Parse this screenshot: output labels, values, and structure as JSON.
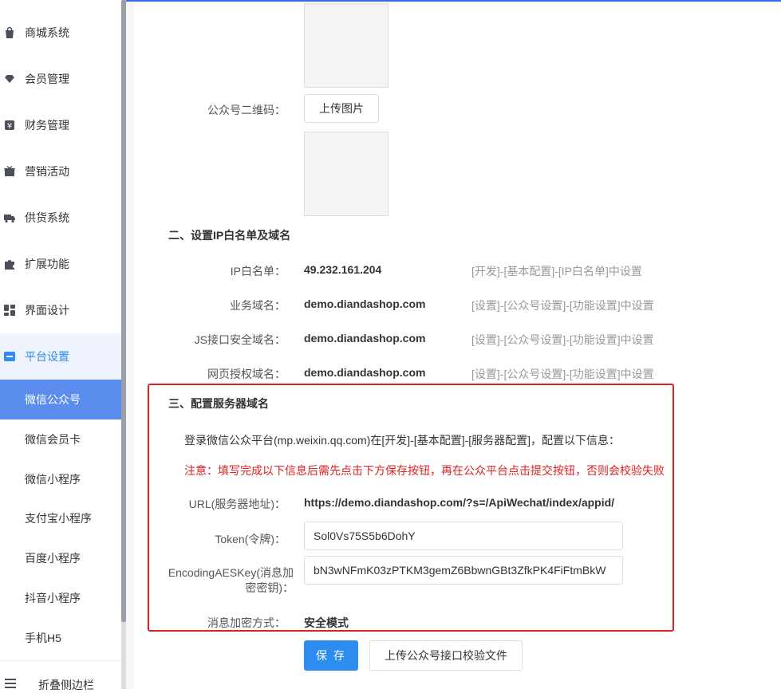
{
  "sidebar": {
    "items": [
      {
        "label": "商城系统",
        "icon": "shopping-bag-icon"
      },
      {
        "label": "会员管理",
        "icon": "diamond-icon"
      },
      {
        "label": "财务管理",
        "icon": "yen-icon"
      },
      {
        "label": "营销活动",
        "icon": "gift-icon"
      },
      {
        "label": "供货系统",
        "icon": "truck-icon"
      },
      {
        "label": "扩展功能",
        "icon": "puzzle-icon"
      },
      {
        "label": "界面设计",
        "icon": "layout-icon"
      },
      {
        "label": "平台设置",
        "icon": "platform-icon"
      }
    ],
    "sub_items": [
      {
        "label": "微信公众号"
      },
      {
        "label": "微信会员卡"
      },
      {
        "label": "微信小程序"
      },
      {
        "label": "支付宝小程序"
      },
      {
        "label": "百度小程序"
      },
      {
        "label": "抖音小程序"
      },
      {
        "label": "手机H5"
      }
    ],
    "collapse_label": "折叠侧边栏"
  },
  "qrcode": {
    "label": "公众号二维码：",
    "upload_label": "上传图片"
  },
  "section2": {
    "title": "二、设置IP白名单及域名",
    "rows": [
      {
        "label": "IP白名单：",
        "value": "49.232.161.204",
        "hint": "[开发]-[基本配置]-[IP白名单]中设置"
      },
      {
        "label": "业务域名：",
        "value": "demo.diandashop.com",
        "hint": "[设置]-[公众号设置]-[功能设置]中设置"
      },
      {
        "label": "JS接口安全域名：",
        "value": "demo.diandashop.com",
        "hint": "[设置]-[公众号设置]-[功能设置]中设置"
      },
      {
        "label": "网页授权域名：",
        "value": "demo.diandashop.com",
        "hint": "[设置]-[公众号设置]-[功能设置]中设置"
      }
    ]
  },
  "section3": {
    "title": "三、配置服务器域名",
    "description": "登录微信公众平台(mp.weixin.qq.com)在[开发]-[基本配置]-[服务器配置]，配置以下信息：",
    "warning": "注意：填写完成以下信息后需先点击下方保存按钮，再在公众平台点击提交按钮，否则会校验失败",
    "url_label": "URL(服务器地址)：",
    "url_value": "https://demo.diandashop.com/?s=/ApiWechat/index/appid/",
    "token_label": "Token(令牌)：",
    "token_value": "Sol0Vs75S5b6DohY",
    "aes_label_line1": "EncodingAESKey(消息加",
    "aes_label_line2": "密密钥)：",
    "aes_value": "bN3wNFmK03zPTKM3gemZ6BbwnGBt3ZfkPK4FiFtmBkW",
    "mode_label": "消息加密方式：",
    "mode_value": "安全模式"
  },
  "actions": {
    "save_label": "保 存",
    "upload_verify_label": "上传公众号接口校验文件"
  },
  "colors": {
    "primary": "#2d8cf0",
    "active_sub": "#5b8def",
    "highlight_border": "#e02020",
    "warning_text": "#e02020"
  }
}
